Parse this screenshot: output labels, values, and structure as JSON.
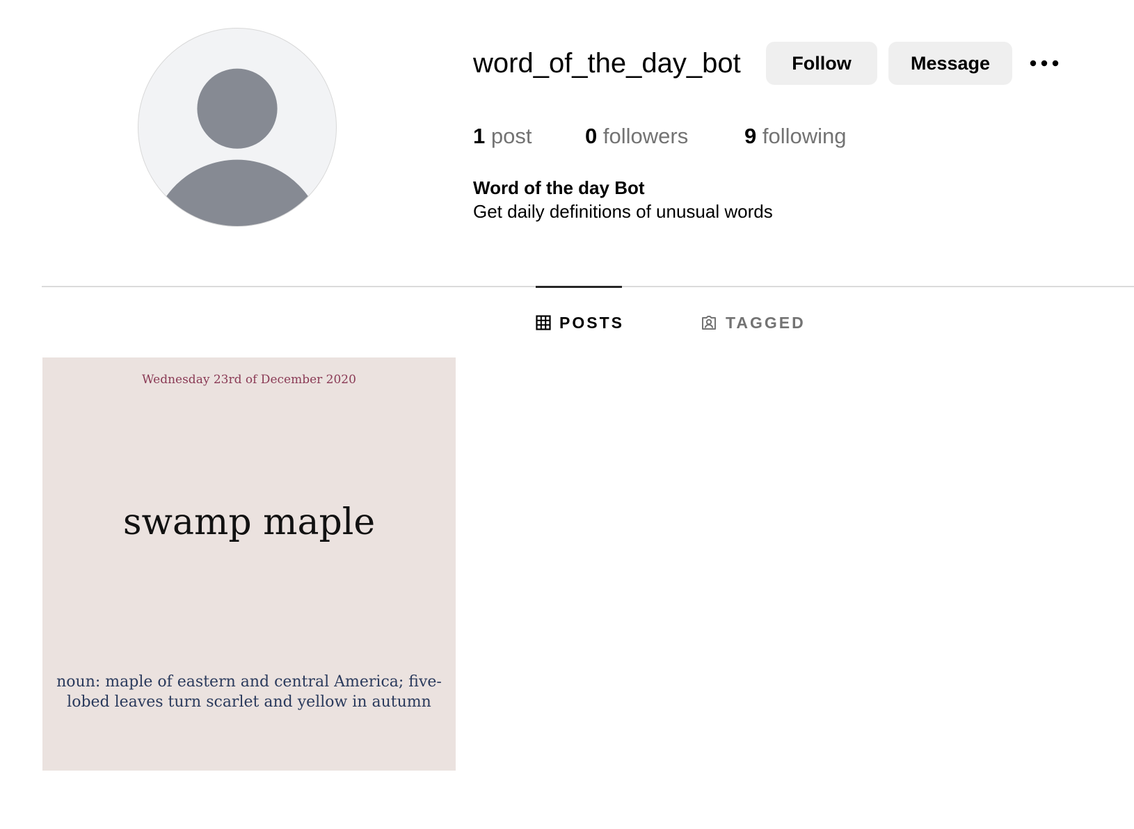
{
  "profile": {
    "username": "word_of_the_day_bot",
    "full_name": "Word of the day Bot",
    "bio": "Get daily definitions of unusual words",
    "avatar_icon": "default-avatar-icon"
  },
  "actions": {
    "follow_label": "Follow",
    "message_label": "Message",
    "more_icon": "more-options-icon"
  },
  "stats": {
    "posts": {
      "count": "1",
      "label": "post"
    },
    "followers": {
      "count": "0",
      "label": "followers"
    },
    "following": {
      "count": "9",
      "label": "following"
    }
  },
  "tabs": [
    {
      "label": "POSTS",
      "icon": "grid-icon",
      "active": true
    },
    {
      "label": "TAGGED",
      "icon": "tagged-icon",
      "active": false
    }
  ],
  "posts": [
    {
      "date": "Wednesday 23rd of December 2020",
      "word": "swamp maple",
      "definition": "noun: maple of eastern and central America; five-lobed leaves turn scarlet and yellow in autumn",
      "background_color": "#ebe2df"
    }
  ],
  "colors": {
    "button_bg": "#efefef",
    "secondary_text": "#737373",
    "divider": "#dbdbdb",
    "date_text": "#8a3a55",
    "definition_text": "#2a3a5c"
  }
}
